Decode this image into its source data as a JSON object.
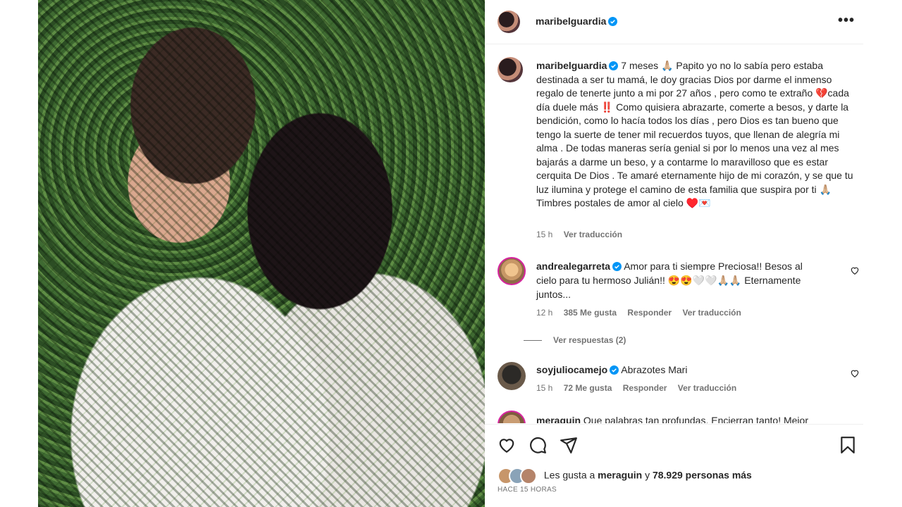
{
  "header": {
    "username": "maribelguardia",
    "more_label": "•••"
  },
  "caption": {
    "username": "maribelguardia",
    "text": "7 meses 🙏🏼 Papito yo no lo sabía pero estaba destinada a ser tu mamá, le doy gracias Dios por darme el inmenso regalo de tenerte junto a mi por 27 años , pero como te extraño 💔cada día duele más ‼️ Como quisiera abrazarte, comerte a besos, y darte la bendición, como lo hacía todos los días , pero Dios es tan bueno que tengo la suerte de tener mil recuerdos tuyos, que llenan de alegría mi alma . De todas maneras sería genial si por lo menos una vez al mes bajarás a darme un beso, y a contarme lo maravilloso que es estar cerquita De Dios . Te amaré eternamente hijo de mi corazón, y se que tu luz ilumina y protege el camino de esta familia que suspira por ti 🙏🏼 Timbres postales de amor al cielo ♥️💌",
    "time": "15 h",
    "translate": "Ver traducción"
  },
  "comments": [
    {
      "username": "andrealegarreta",
      "text": "Amor para ti siempre Preciosa!! Besos al cielo para tu hermoso Julián!! 😍😍🤍🤍🙏🏼🙏🏼 Eternamente juntos...",
      "time": "12 h",
      "likes": "385 Me gusta",
      "reply": "Responder",
      "translate": "Ver traducción",
      "view_replies": "Ver respuestas (2)"
    },
    {
      "username": "soyjuliocamejo",
      "text": "Abrazotes Mari",
      "time": "15 h",
      "likes": "72 Me gusta",
      "reply": "Responder",
      "translate": "Ver traducción"
    },
    {
      "username": "meraguin",
      "text": "Que palabras tan profundas. Encierran tanto! Mejor"
    }
  ],
  "likes": {
    "prefix": "Les gusta a",
    "user": "meraguin",
    "middle": "y",
    "count": "78.929 personas más"
  },
  "time_ago": "HACE 15 HORAS",
  "colors": {
    "verified": "#0095f6",
    "text": "#262626",
    "muted": "#737373",
    "border": "#efefef"
  }
}
